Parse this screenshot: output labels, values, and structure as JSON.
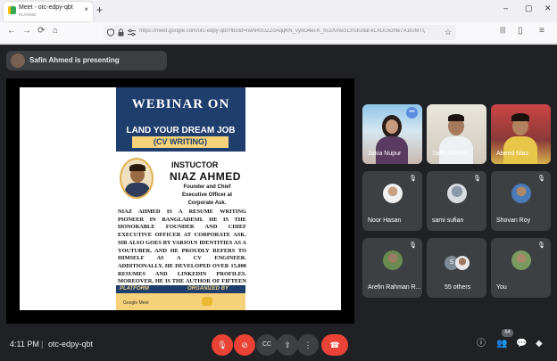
{
  "browser": {
    "tab_title": "Meet - otc-edpy-qbt",
    "tab_subtitle": "PLAYING",
    "close_glyph": "×",
    "newtab_glyph": "+",
    "window_controls": [
      "–",
      "▢",
      "✕"
    ],
    "nav_glyphs": [
      "←",
      "→",
      "⟳",
      "⌂"
    ],
    "url": "https://meet.google.com/otc-edpy-qbt?fbclid=IwAR0UZZoAqqKN_vyoO4ei-K_hs3Xmw1Cm3Udal-kLXDOxzNk7A1lUMTQ",
    "url_icons": [
      "shield-icon",
      "lock-icon",
      "tune-icon"
    ],
    "right_icons": [
      "library-icon",
      "sidebar-icon",
      "menu-icon"
    ],
    "right_glyphs": [
      "|||",
      "▯",
      "≡"
    ]
  },
  "presenter_banner": "Safin Ahmed is presenting",
  "slide": {
    "heading": "WEBINAR ON",
    "title": "LAND YOUR DREAM JOB",
    "subtitle": "(CV WRITING)",
    "instructor_label": "INSTUCTOR",
    "instructor_name": "NIAZ AHMED",
    "instructor_role": "Founder and Chief Executive Officer at Corporate Ask.",
    "bio": "Niaz Ahmed is a resume writing pioneer in Bangladesh. He is the honorable founder and Chief Executive Officer at Corporate Ask. Sir also goes by various identities as a YouTuber, and he proudly refers to himself as a CV Engineer. Additionally, he developed over 15,000 resumes and LinkedIn profiles. Moreover, he is the author of fifteen books.",
    "platform_label": "PLATFORM",
    "organized_label": "ORGANIZED BY",
    "platform_name": "Google Meet"
  },
  "participants": [
    {
      "name": "Jakia Nupur",
      "kind": "video"
    },
    {
      "name": "Safin Ahmed",
      "kind": "video"
    },
    {
      "name": "Abeed Niaz",
      "kind": "video"
    },
    {
      "name": "Noor Hasan",
      "kind": "avatar"
    },
    {
      "name": "sami sufian",
      "kind": "avatar"
    },
    {
      "name": "Shovan Roy",
      "kind": "avatar"
    },
    {
      "name": "Arefin Rahman R...",
      "kind": "avatar"
    },
    {
      "name": "55 others",
      "kind": "group",
      "group_initial": "S"
    },
    {
      "name": "You",
      "kind": "avatar"
    }
  ],
  "mic_off_glyph": "🎙",
  "more_glyph": "•••",
  "bottom_bar": {
    "time": "4:11 PM",
    "separator": "|",
    "meeting_code": "otc-edpy-qbt",
    "controls": [
      "🎙",
      "⊘",
      "CC",
      "⇧",
      "⋮",
      "☎"
    ],
    "right_glyphs": [
      "ⓘ",
      "👥",
      "💬",
      "◆"
    ],
    "participant_count": "64"
  },
  "colors": {
    "meet_bg": "#202124",
    "tile_bg": "#3c4043",
    "danger": "#ea4335",
    "slide_navy": "#1f3e6d",
    "slide_gold": "#f5d27a"
  }
}
